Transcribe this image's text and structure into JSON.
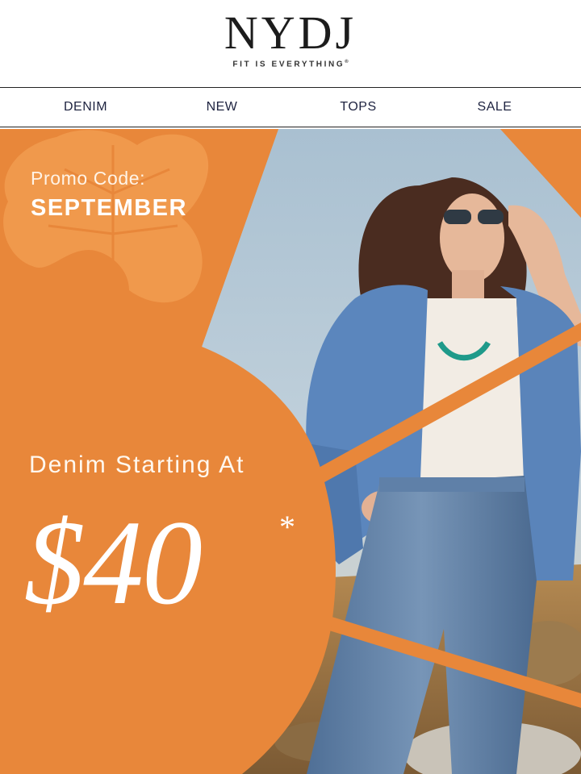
{
  "brand": {
    "logo": "NYDJ",
    "tagline": "FIT IS EVERYTHING",
    "registered_mark": "®"
  },
  "nav": {
    "items": [
      {
        "label": "DENIM"
      },
      {
        "label": "NEW"
      },
      {
        "label": "TOPS"
      },
      {
        "label": "SALE"
      }
    ]
  },
  "hero": {
    "promo_label": "Promo Code:",
    "promo_code": "SEPTEMBER",
    "headline": "Denim Starting At",
    "price": "$40",
    "price_footnote_mark": "*"
  },
  "colors": {
    "accent_orange": "#E8873A",
    "leaf_orange": "#F19A4E",
    "nav_text": "#1E2340",
    "sky": "#AFC3D3"
  },
  "icons": {
    "decorative_leaf": "maple-leaf-icon"
  }
}
